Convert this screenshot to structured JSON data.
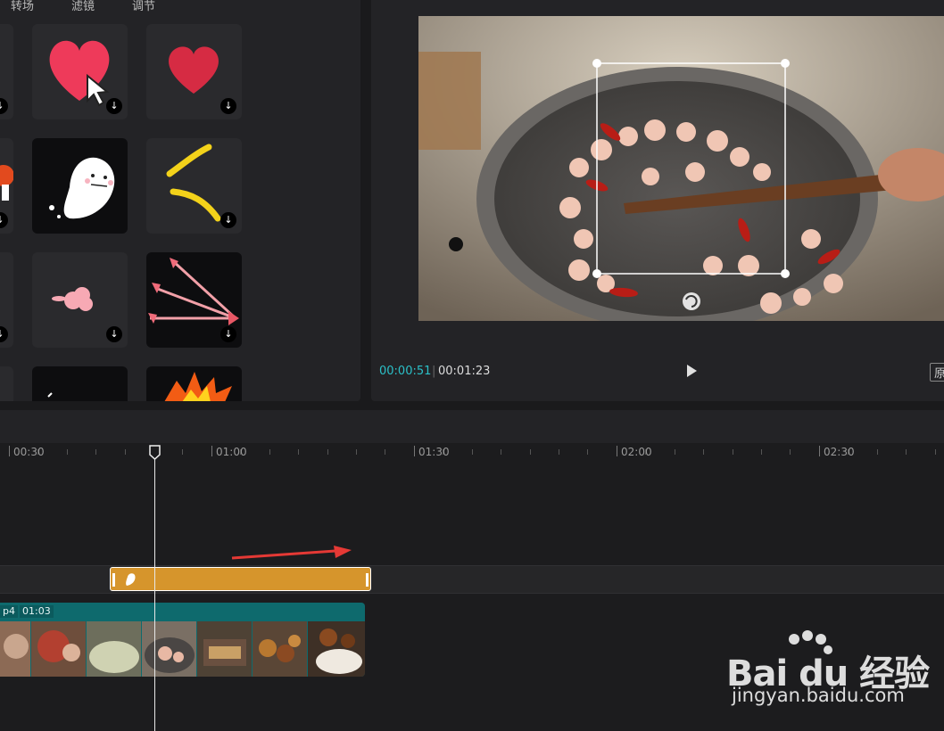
{
  "library": {
    "tabs": [
      "转场",
      "滤镜",
      "调节"
    ],
    "download_glyph": "↓"
  },
  "preview": {
    "current_time": "00:00:51",
    "separator": "|",
    "total_time": "00:01:23",
    "original_label": "原"
  },
  "timeline": {
    "ticks": [
      "00:30",
      "01:00",
      "01:30",
      "02:00",
      "02:30"
    ],
    "clip_labels": [
      "p4",
      "01:03"
    ]
  },
  "watermark": {
    "brand": "Bai du 经验",
    "url": "jingyan.baidu.com"
  },
  "colors": {
    "accent": "#2bc0c8",
    "sticker_clip": "#d6952c",
    "video_clip": "#0e6a6d",
    "arrow": "#e53935"
  }
}
